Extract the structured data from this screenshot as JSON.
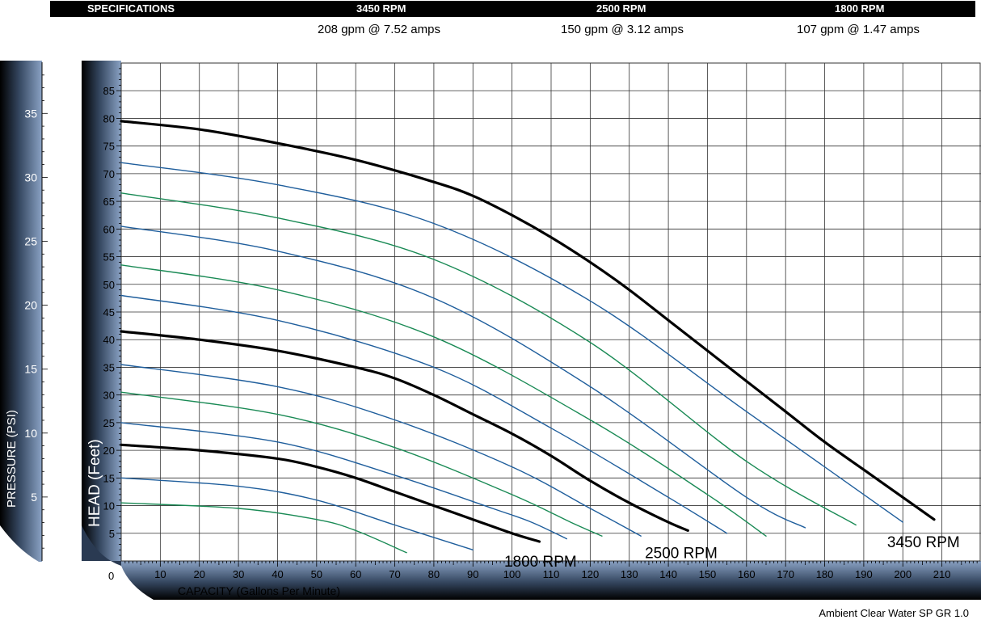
{
  "specifications": {
    "header_label": "SPECIFICATIONS",
    "columns": [
      {
        "rpm": "3450 RPM",
        "value": "208 gpm @ 7.52 amps"
      },
      {
        "rpm": "2500 RPM",
        "value": "150 gpm @ 3.12 amps"
      },
      {
        "rpm": "1800 RPM",
        "value": "107 gpm @ 1.47 amps"
      }
    ]
  },
  "footnote": "Ambient Clear Water SP GR 1.0",
  "colors": {
    "main_curve": "#000000",
    "blue_curve": "#1f5e9c",
    "green_curve": "#1a8a55",
    "axis_band": "#8aa2c4",
    "grid": "#333333"
  },
  "chart_data": {
    "type": "line",
    "xlabel": "CAPACITY (Gallons Per Minute)",
    "ylabel": "HEAD (Feet)",
    "y2label": "PRESSURE (PSI)",
    "origin_label": "0",
    "xlim": [
      0,
      220
    ],
    "ylim": [
      0,
      90
    ],
    "y2lim": [
      0,
      39
    ],
    "xticks": [
      10,
      20,
      30,
      40,
      50,
      60,
      70,
      80,
      90,
      100,
      110,
      120,
      130,
      140,
      150,
      160,
      170,
      180,
      190,
      200,
      210
    ],
    "yticks": [
      5,
      10,
      15,
      20,
      25,
      30,
      35,
      40,
      45,
      50,
      55,
      60,
      65,
      70,
      75,
      80,
      85
    ],
    "y2ticks": [
      5,
      10,
      15,
      20,
      25,
      30,
      35
    ],
    "grid": true,
    "series": [
      {
        "name": "3450 RPM",
        "style": "main",
        "label_at": [
          196,
          2.5
        ],
        "x": [
          0,
          20,
          40,
          60,
          80,
          90,
          100,
          110,
          120,
          130,
          140,
          150,
          160,
          170,
          180,
          190,
          200,
          208
        ],
        "y": [
          79.5,
          78,
          75.5,
          72.5,
          68.5,
          66,
          62.5,
          58.5,
          54,
          49,
          43.5,
          38,
          32.5,
          27,
          21.5,
          16.5,
          11.5,
          7.5
        ]
      },
      {
        "style": "blue",
        "x": [
          0,
          40,
          80,
          120,
          160,
          200
        ],
        "y": [
          72,
          68,
          61,
          47,
          27,
          7
        ]
      },
      {
        "style": "green",
        "x": [
          0,
          40,
          80,
          120,
          160,
          188
        ],
        "y": [
          66.5,
          62,
          54.5,
          39.5,
          18,
          6.5
        ]
      },
      {
        "style": "blue",
        "x": [
          0,
          40,
          80,
          120,
          160,
          175
        ],
        "y": [
          60.5,
          56,
          47.5,
          31.5,
          11.5,
          6
        ]
      },
      {
        "style": "green",
        "x": [
          0,
          40,
          80,
          120,
          150,
          165
        ],
        "y": [
          53.5,
          49,
          40.5,
          25.5,
          12,
          4.5
        ]
      },
      {
        "style": "blue",
        "x": [
          0,
          40,
          80,
          110,
          140,
          155
        ],
        "y": [
          48,
          43.5,
          35,
          24,
          11.5,
          5
        ]
      },
      {
        "style": "main",
        "name": "2500 RPM",
        "label_at": [
          134,
          0.5
        ],
        "x": [
          0,
          20,
          40,
          60,
          70,
          80,
          90,
          100,
          110,
          120,
          130,
          140,
          145
        ],
        "y": [
          41.5,
          40,
          38,
          35,
          33,
          30,
          26.5,
          23,
          19,
          14.5,
          10.5,
          7,
          5.5
        ]
      },
      {
        "style": "blue",
        "x": [
          0,
          40,
          70,
          100,
          120,
          133
        ],
        "y": [
          35.5,
          31.5,
          25.5,
          17,
          9.5,
          4.5
        ]
      },
      {
        "style": "green",
        "x": [
          0,
          40,
          70,
          100,
          115,
          123
        ],
        "y": [
          30.5,
          26.5,
          20.5,
          12,
          7,
          4.5
        ]
      },
      {
        "style": "blue",
        "x": [
          0,
          40,
          70,
          95,
          105,
          114
        ],
        "y": [
          25,
          21.5,
          15.5,
          9.5,
          7,
          4
        ]
      },
      {
        "style": "main",
        "name": "1800 RPM",
        "label_at": [
          98,
          -1
        ],
        "x": [
          0,
          20,
          40,
          50,
          60,
          70,
          80,
          90,
          100,
          107
        ],
        "y": [
          21,
          20,
          18.5,
          17,
          15,
          12.5,
          10,
          7.5,
          5,
          3.5
        ]
      },
      {
        "style": "blue",
        "x": [
          0,
          30,
          50,
          70,
          90
        ],
        "y": [
          15,
          13.5,
          11,
          6.5,
          2
        ]
      },
      {
        "style": "green",
        "x": [
          0,
          30,
          50,
          60,
          73
        ],
        "y": [
          10.5,
          9.5,
          7.5,
          5.5,
          1.5
        ]
      }
    ]
  }
}
